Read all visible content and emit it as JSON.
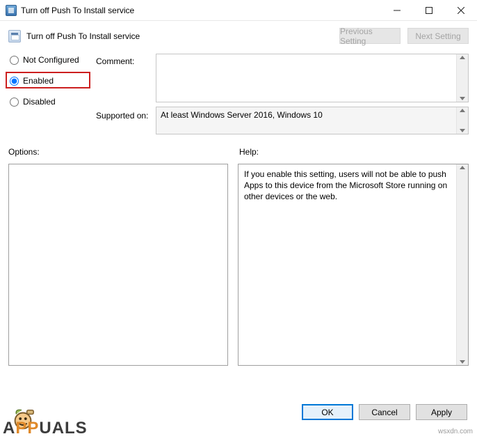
{
  "titlebar": {
    "title": "Turn off Push To Install service"
  },
  "header": {
    "policy_title": "Turn off Push To Install service",
    "prev_label": "Previous Setting",
    "next_label": "Next Setting"
  },
  "radios": {
    "not_configured": "Not Configured",
    "enabled": "Enabled",
    "disabled": "Disabled",
    "selected": "enabled"
  },
  "fields": {
    "comment_label": "Comment:",
    "comment_value": "",
    "supported_label": "Supported on:",
    "supported_value": "At least Windows Server 2016, Windows 10"
  },
  "sections": {
    "options_label": "Options:",
    "help_label": "Help:"
  },
  "options_panel": "",
  "help_panel": "If you enable this setting, users will not be able to push Apps to this device from the Microsoft Store running on other devices or the web.",
  "footer": {
    "ok": "OK",
    "cancel": "Cancel",
    "apply": "Apply"
  },
  "watermarks": {
    "main_pre": "A",
    "main_mid": "PP",
    "main_post": "UALS",
    "side": "wsxdn.com"
  }
}
